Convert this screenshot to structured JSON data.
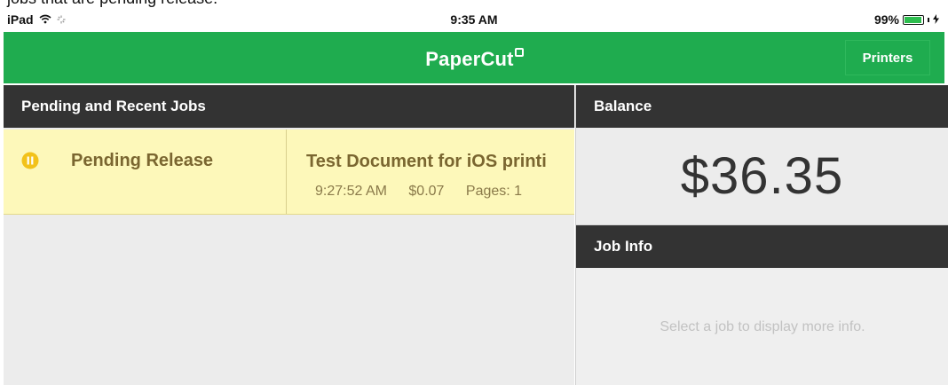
{
  "caption": "jobs that are pending release.",
  "status_bar": {
    "device": "iPad",
    "time": "9:35 AM",
    "battery": "99%",
    "battery_level": 0.99
  },
  "nav": {
    "logo": "PaperCut",
    "printers_label": "Printers"
  },
  "jobs_panel": {
    "header": "Pending and Recent Jobs",
    "jobs": [
      {
        "status": "Pending Release",
        "title": "Test Document for iOS printi",
        "time": "9:27:52 AM",
        "cost": "$0.07",
        "pages": "Pages: 1"
      }
    ]
  },
  "balance": {
    "header": "Balance",
    "value": "$36.35"
  },
  "job_info": {
    "header": "Job Info",
    "placeholder": "Select a job to display more info."
  },
  "colors": {
    "nav_green": "#1fac4f",
    "header_dark": "#333333",
    "pending_yellow": "#fdf8ba",
    "pending_icon": "#f2c21a"
  }
}
